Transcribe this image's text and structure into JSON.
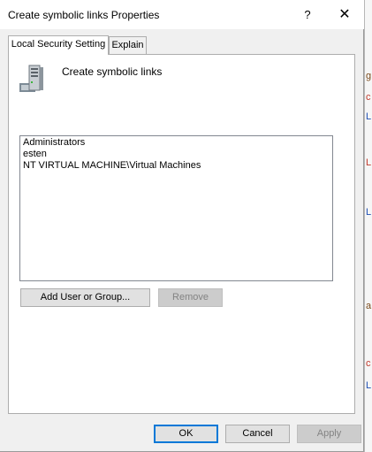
{
  "window": {
    "title": "Create symbolic links Properties",
    "help_label": "?",
    "close_label": "✕"
  },
  "tabs": [
    {
      "label": "Local Security Setting",
      "active": true
    },
    {
      "label": "Explain",
      "active": false
    }
  ],
  "policy": {
    "icon": "server-icon",
    "name": "Create symbolic links"
  },
  "principals": [
    "Administrators",
    "esten",
    "NT VIRTUAL MACHINE\\Virtual Machines"
  ],
  "actions": {
    "add_label": "Add User or Group...",
    "remove_label": "Remove"
  },
  "footer": {
    "ok_label": "OK",
    "cancel_label": "Cancel",
    "apply_label": "Apply"
  },
  "colors": {
    "accent": "#0078d7",
    "dialog_bg": "#f0f0f0"
  }
}
